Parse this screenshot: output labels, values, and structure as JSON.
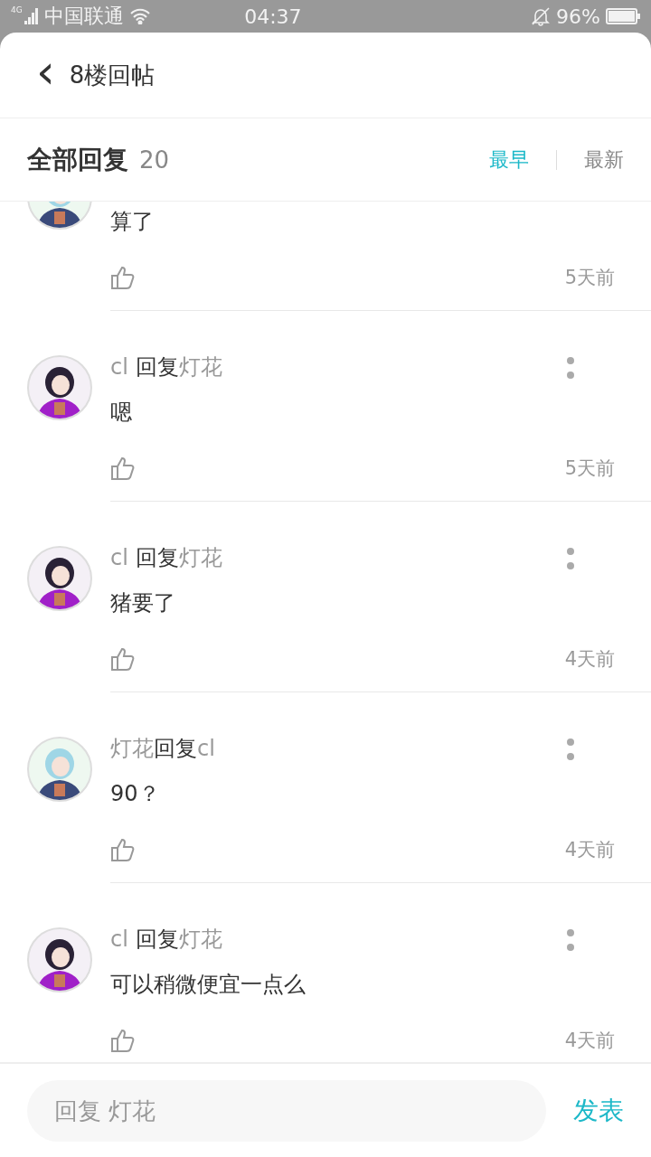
{
  "status_bar": {
    "network": "4G",
    "carrier": "中国联通",
    "time": "04:37",
    "battery": "96%"
  },
  "header": {
    "back": "‹",
    "title": "8楼回帖"
  },
  "sort_bar": {
    "title": "全部回复",
    "count": "20",
    "options": [
      {
        "label": "最早",
        "selected": true
      },
      {
        "label": "最新",
        "selected": false
      }
    ]
  },
  "replies": [
    {
      "kind": "light",
      "body": "算了",
      "time": "5天前"
    },
    {
      "kind": "dark",
      "author": "cl ",
      "action": "回复",
      "target": "灯花",
      "body": "嗯",
      "time": "5天前"
    },
    {
      "kind": "dark",
      "author": "cl ",
      "action": "回复",
      "target": "灯花",
      "body": "猪要了",
      "time": "4天前"
    },
    {
      "kind": "light",
      "author": "灯花",
      "action": "回复",
      "target": "cl",
      "body": "90？",
      "time": "4天前"
    },
    {
      "kind": "dark",
      "author": "cl ",
      "action": "回复",
      "target": "灯花",
      "body": "可以稍微便宜一点么",
      "time": "4天前"
    }
  ],
  "composer": {
    "placeholder": "回复 灯花",
    "send": "发表"
  }
}
